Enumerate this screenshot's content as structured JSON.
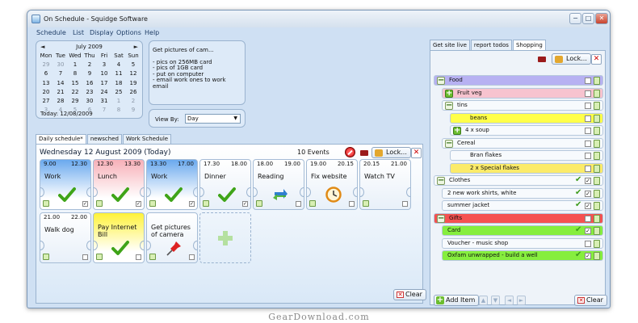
{
  "window": {
    "title": "On Schedule - Squidge Software",
    "min": "−",
    "max": "□",
    "close": "✕"
  },
  "menu": [
    "Schedule",
    "List",
    "Display",
    "Options",
    "Help"
  ],
  "calendar": {
    "prev": "◄",
    "next": "►",
    "month": "July 2009",
    "weekdays": [
      "Mon",
      "Tue",
      "Wed",
      "Thu",
      "Fri",
      "Sat",
      "Sun"
    ],
    "weeks": [
      [
        "29",
        "30",
        "1",
        "2",
        "3",
        "4",
        "5"
      ],
      [
        "6",
        "7",
        "8",
        "9",
        "10",
        "11",
        "12"
      ],
      [
        "13",
        "14",
        "15",
        "16",
        "17",
        "18",
        "19"
      ],
      [
        "20",
        "21",
        "22",
        "23",
        "24",
        "25",
        "26"
      ],
      [
        "27",
        "28",
        "29",
        "30",
        "31",
        "1",
        "2"
      ],
      [
        "3",
        "4",
        "5",
        "6",
        "7",
        "8",
        "9"
      ]
    ],
    "today": "Today: 12/08/2009"
  },
  "note": {
    "title": "Get pictures of cam...",
    "lines": [
      "- pics on 256MB card",
      "- pics of 1GB card",
      "- put on computer",
      "- email work ones to work email"
    ]
  },
  "viewby": {
    "label": "View By:",
    "value": "Day"
  },
  "tabs": [
    "Daily schedule*",
    "newsched",
    "Work Schedule"
  ],
  "schedule": {
    "date": "Wednesday 12 August 2009 (Today)",
    "count": "10 Events",
    "lock": "Lock...",
    "clear": "Clear",
    "events": [
      {
        "start": "9.00",
        "end": "12.30",
        "title": "Work",
        "color": "#6aa9ee",
        "icon": "check-icon",
        "checked": true
      },
      {
        "start": "12.30",
        "end": "13.30",
        "title": "Lunch",
        "color": "#f7b0b8",
        "icon": "check-icon",
        "checked": true
      },
      {
        "start": "13.30",
        "end": "17.00",
        "title": "Work",
        "color": "#6aa9ee",
        "icon": "check-icon",
        "checked": true
      },
      {
        "start": "17.30",
        "end": "18.00",
        "title": "Dinner",
        "color": "",
        "icon": "check-icon",
        "checked": true
      },
      {
        "start": "18.00",
        "end": "19.00",
        "title": "Reading",
        "color": "",
        "icon": "refresh-icon",
        "checked": false
      },
      {
        "start": "19.00",
        "end": "20.15",
        "title": "Fix website",
        "color": "",
        "icon": "clock-icon",
        "checked": false
      },
      {
        "start": "20.15",
        "end": "21.00",
        "title": "Watch TV",
        "color": "",
        "icon": "",
        "checked": false
      },
      {
        "start": "21.00",
        "end": "22.00",
        "title": "Walk dog",
        "color": "",
        "icon": "",
        "checked": false
      },
      {
        "start": "",
        "end": "",
        "title": "Pay Internet Bill",
        "color": "#fff23a",
        "icon": "check-icon",
        "checked": false
      },
      {
        "start": "",
        "end": "",
        "title": "Get pictures of camera",
        "color": "",
        "icon": "pin-icon",
        "checked": false
      }
    ]
  },
  "right": {
    "tabs": [
      "Get site live",
      "report todos",
      "Shopping"
    ],
    "lock": "Lock...",
    "add": "Add Item",
    "clear": "Clear",
    "items": [
      {
        "label": "Food",
        "level": 0,
        "color": "#b7b1f2",
        "toggle": "−",
        "checked": false
      },
      {
        "label": "Fruit veg",
        "level": 1,
        "color": "#f7c3cf",
        "toggle": "+",
        "checked": false
      },
      {
        "label": "tins",
        "level": 1,
        "color": "",
        "toggle": "−",
        "checked": false
      },
      {
        "label": "beans",
        "level": 2,
        "color": "#ffff4a",
        "toggle": "",
        "checked": false
      },
      {
        "label": "4 x soup",
        "level": 2,
        "color": "",
        "toggle": "+",
        "checked": false
      },
      {
        "label": "Cereal",
        "level": 1,
        "color": "",
        "toggle": "−",
        "checked": false
      },
      {
        "label": "Bran flakes",
        "level": 2,
        "color": "",
        "toggle": "",
        "checked": false
      },
      {
        "label": "2 x Special flakes",
        "level": 2,
        "color": "#fbeb6a",
        "toggle": "",
        "checked": false
      },
      {
        "label": "Clothes",
        "level": 0,
        "color": "",
        "toggle": "−",
        "checked": true
      },
      {
        "label": "2 new work shirts, white",
        "level": 1,
        "color": "",
        "toggle": "",
        "checked": true
      },
      {
        "label": "summer jacket",
        "level": 1,
        "color": "",
        "toggle": "",
        "checked": true
      },
      {
        "label": "Gifts",
        "level": 0,
        "color": "#f55151",
        "toggle": "−",
        "checked": false
      },
      {
        "label": "Card",
        "level": 1,
        "color": "#86ee3e",
        "toggle": "",
        "checked": true
      },
      {
        "label": "Voucher - music shop",
        "level": 1,
        "color": "",
        "toggle": "",
        "checked": false
      },
      {
        "label": "Oxfam unwrapped - build a well",
        "level": 1,
        "color": "#86ee3e",
        "toggle": "",
        "checked": true
      }
    ]
  },
  "watermark": "GearDownload.com"
}
